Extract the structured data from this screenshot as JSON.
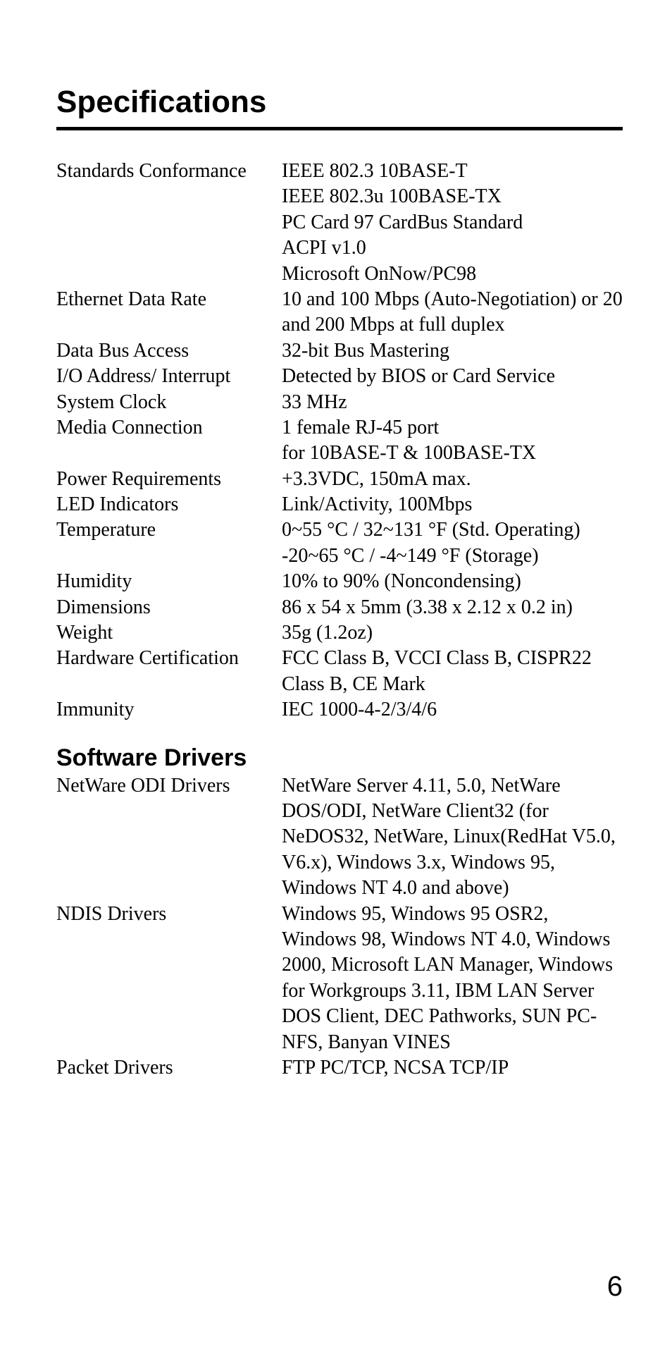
{
  "title": "Specifications",
  "specs": [
    {
      "label": "Standards Conformance",
      "value": "IEEE 802.3 10BASE-T\nIEEE 802.3u 100BASE-TX\nPC Card 97 CardBus Standard\nACPI v1.0\nMicrosoft OnNow/PC98"
    },
    {
      "label": "Ethernet Data Rate",
      "value": "10 and 100 Mbps (Auto-Negotiation) or 20 and 200 Mbps at full duplex"
    },
    {
      "label": "Data Bus Access",
      "value": "32-bit Bus Mastering"
    },
    {
      "label": "I/O Address/ Interrupt",
      "value": "Detected by BIOS or Card Service"
    },
    {
      "label": "System Clock",
      "value": "33 MHz"
    },
    {
      "label": "Media Connection",
      "value": "1 female RJ-45 port\nfor 10BASE-T & 100BASE-TX"
    },
    {
      "label": "Power Requirements",
      "value": "+3.3VDC, 150mA max."
    },
    {
      "label": "LED Indicators",
      "value": "Link/Activity, 100Mbps"
    },
    {
      "label": "Temperature",
      "value": "0~55 °C / 32~131 °F (Std. Operating)\n-20~65 °C / -4~149 °F (Storage)"
    },
    {
      "label": "Humidity",
      "value": "10% to 90% (Noncondensing)"
    },
    {
      "label": "Dimensions",
      "value": "86 x 54 x 5mm (3.38 x 2.12 x 0.2 in)"
    },
    {
      "label": "Weight",
      "value": "35g (1.2oz)"
    },
    {
      "label": "Hardware Certification",
      "value": "FCC Class B, VCCI Class B, CISPR22 Class B, CE Mark"
    },
    {
      "label": "Immunity",
      "value": "IEC  1000-4-2/3/4/6"
    }
  ],
  "drivers_heading": "Software Drivers",
  "drivers": [
    {
      "label": "NetWare ODI Drivers",
      "value": "NetWare Server 4.11, 5.0, NetWare DOS/ODI, NetWare Client32 (for NeDOS32, NetWare, Linux(RedHat V5.0, V6.x), Windows 3.x, Windows 95, Windows NT 4.0 and above)"
    },
    {
      "label": "NDIS Drivers",
      "value": "Windows 95, Windows 95 OSR2, Windows 98, Windows NT 4.0, Windows 2000, Microsoft LAN Manager, Windows for Workgroups 3.11, IBM LAN Server DOS Client, DEC Pathworks, SUN PC-NFS, Banyan VINES"
    },
    {
      "label": "Packet Drivers",
      "value": "FTP PC/TCP, NCSA TCP/IP"
    }
  ],
  "page_number": "6"
}
